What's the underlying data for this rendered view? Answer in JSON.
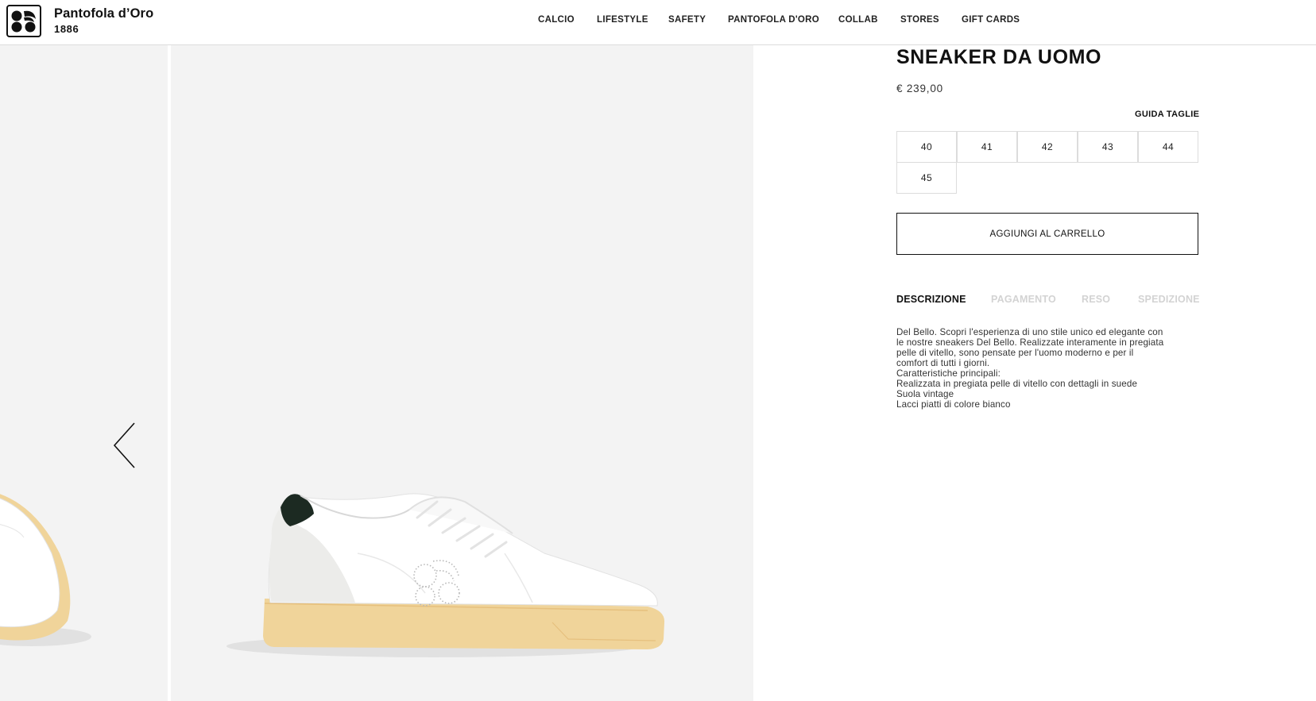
{
  "header": {
    "brand_name": "Pantofola d’Oro",
    "brand_year": "1886",
    "nav": [
      "CALCIO",
      "LIFESTYLE",
      "SAFETY",
      "PANTOFOLA D'ORO",
      "COLLAB",
      "STORES",
      "GIFT CARDS"
    ]
  },
  "product": {
    "title": "SNEAKER DA UOMO",
    "price": "€ 239,00",
    "size_guide": "GUIDA TAGLIE",
    "sizes": [
      "40",
      "41",
      "42",
      "43",
      "44",
      "45"
    ],
    "add_to_cart": "AGGIUNGI AL CARRELLO",
    "tabs": [
      "DESCRIZIONE",
      "PAGAMENTO",
      "RESO",
      "SPEDIZIONE"
    ],
    "active_tab": "DESCRIZIONE",
    "description": [
      "Del Bello. Scopri l'esperienza di uno stile unico ed elegante con",
      "le nostre sneakers Del Bello. Realizzate interamente in pregiata",
      "pelle di vitello, sono pensate per l'uomo moderno e per il",
      "comfort di tutti i giorni.",
      "Caratteristiche principali:",
      "Realizzata in pregiata pelle di vitello con dettagli in suede",
      "Suola vintage",
      "Lacci piatti di colore bianco"
    ]
  },
  "gallery": {
    "icons": {
      "prev": "chevron-left-icon",
      "logo": "pantofola-logo-icon"
    }
  },
  "colors": {
    "gallery_bg": "#f3f3f3",
    "sole": "#f0d49a",
    "heel_tab": "#1c2a22",
    "inactive_tab": "#d3d3d3"
  }
}
